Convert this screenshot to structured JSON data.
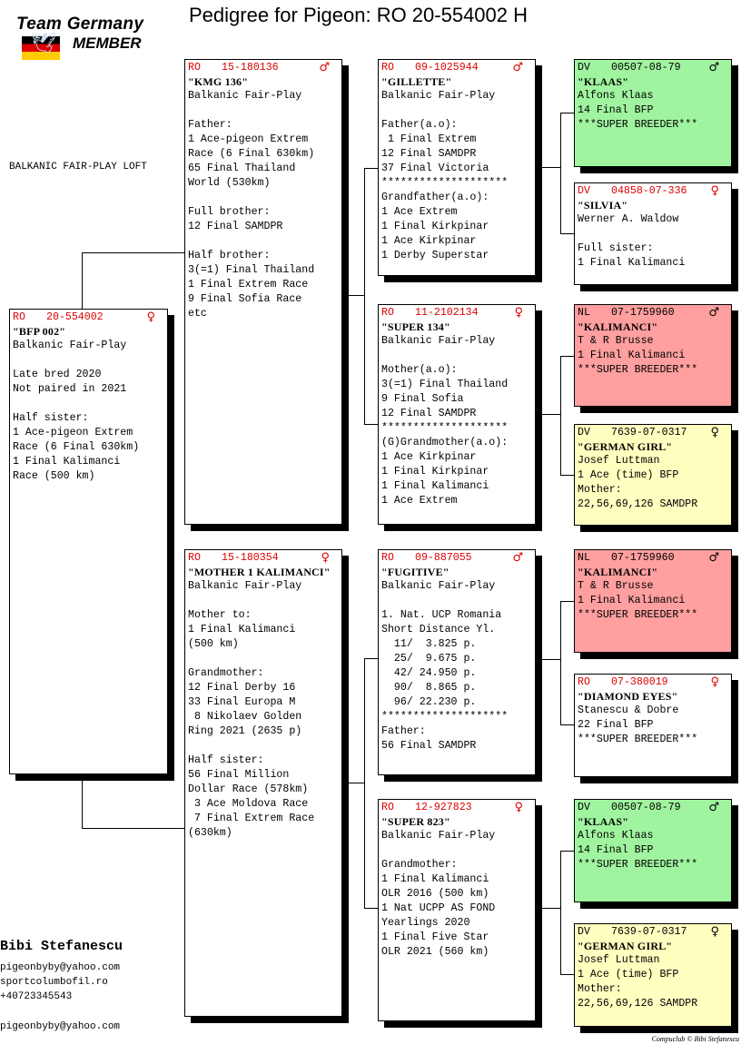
{
  "header": {
    "logo_line1": "Team Germany",
    "logo_line2": "MEMBER",
    "title": "Pedigree for Pigeon: RO  20-554002 H",
    "loft": "BALKANIC FAIR-PLAY LOFT"
  },
  "colors": {
    "ring_red": "#dd0000",
    "green": "#a0f4a0",
    "red": "#ff9f9f",
    "yellow": "#ffffc0",
    "white": "#ffffff"
  },
  "pigeons": [
    {
      "id": "subject",
      "cc": "RO",
      "ring": "20-554002",
      "sex": "female",
      "color": "white",
      "lines": [
        "\"BFP 002\"",
        "Balkanic Fair-Play",
        "",
        "Late bred 2020",
        "Not paired in 2021",
        "",
        "Half sister:",
        "1 Ace-pigeon Extrem",
        "Race (6 Final 630km)",
        "1 Final Kalimanci",
        "Race (500 km)"
      ]
    },
    {
      "id": "father",
      "cc": "RO",
      "ring": "15-180136",
      "sex": "male",
      "color": "white",
      "lines": [
        "\"KMG 136\"",
        "Balkanic Fair-Play",
        "",
        "Father:",
        "1 Ace-pigeon Extrem",
        "Race (6 Final 630km)",
        "65 Final Thailand",
        "World (530km)",
        "",
        "Full brother:",
        "12 Final SAMDPR",
        "",
        "Half brother:",
        "3(=1) Final Thailand",
        "1 Final Extrem Race",
        "9 Final Sofia Race",
        "etc"
      ]
    },
    {
      "id": "mother",
      "cc": "RO",
      "ring": "15-180354",
      "sex": "female",
      "color": "white",
      "lines": [
        "\"MOTHER 1 KALIMANCI\"",
        "Balkanic Fair-Play",
        "",
        "Mother to:",
        "1 Final Kalimanci",
        "(500 km)",
        "",
        "Grandmother:",
        "12 Final Derby 16",
        "33 Final Europa M",
        " 8 Nikolaev Golden",
        "Ring 2021 (2635 p)",
        "",
        "Half sister:",
        "56 Final Million",
        "Dollar Race (578km)",
        " 3 Ace Moldova Race",
        " 7 Final Extrem Race",
        "(630km)"
      ]
    },
    {
      "id": "ff",
      "cc": "RO",
      "ring": "09-1025944",
      "sex": "male",
      "color": "white",
      "lines": [
        "\"GILLETTE\"",
        "Balkanic Fair-Play",
        "",
        "Father(a.o):",
        " 1 Final Extrem",
        "12 Final SAMDPR",
        "37 Final Victoria",
        "********************",
        "Grandfather(a.o):",
        "1 Ace Extrem",
        "1 Final Kirkpinar",
        "1 Ace Kirkpinar",
        "1 Derby Superstar"
      ]
    },
    {
      "id": "fm",
      "cc": "RO",
      "ring": "11-2102134",
      "sex": "female",
      "color": "white",
      "lines": [
        "\"SUPER 134\"",
        "Balkanic Fair-Play",
        "",
        "Mother(a.o):",
        "3(=1) Final Thailand",
        "9 Final Sofia",
        "12 Final SAMDPR",
        "********************",
        "(G)Grandmother(a.o):",
        "1 Ace Kirkpinar",
        "1 Final Kirkpinar",
        "1 Final Kalimanci",
        "1 Ace Extrem"
      ]
    },
    {
      "id": "mf",
      "cc": "RO",
      "ring": "09-887055",
      "sex": "male",
      "color": "white",
      "lines": [
        "\"FUGITIVE\"",
        "Balkanic Fair-Play",
        "",
        "1. Nat. UCP Romania",
        "Short Distance Yl.",
        "  11/  3.825 p.",
        "  25/  9.675 p.",
        "  42/ 24.950 p.",
        "  90/  8.865 p.",
        "  96/ 22.230 p.",
        "********************",
        "Father:",
        "56 Final SAMDPR"
      ]
    },
    {
      "id": "mm",
      "cc": "RO",
      "ring": "12-927823",
      "sex": "female",
      "color": "white",
      "lines": [
        "\"SUPER 823\"",
        "Balkanic Fair-Play",
        "",
        "Grandmother:",
        "1 Final Kalimanci",
        "OLR 2016 (500 km)",
        "1 Nat UCPP AS FOND",
        "Yearlings 2020",
        "1 Final Five Star",
        "OLR 2021 (560 km)"
      ]
    },
    {
      "id": "fff",
      "cc": "DV",
      "ring": "00507-08-79",
      "sex": "male",
      "color": "green",
      "lines": [
        "\"KLAAS\"",
        "Alfons Klaas",
        "14 Final BFP",
        "***SUPER BREEDER***"
      ]
    },
    {
      "id": "ffm",
      "cc": "DV",
      "ring": "04858-07-336",
      "sex": "female",
      "color": "white",
      "lines": [
        "\"SILVIA\"",
        "Werner A. Waldow",
        "",
        "Full sister:",
        "1 Final Kalimanci"
      ]
    },
    {
      "id": "fmf",
      "cc": "NL",
      "ring": "07-1759960",
      "sex": "male",
      "color": "red",
      "lines": [
        "\"KALIMANCI\"",
        "T & R Brusse",
        "1 Final Kalimanci",
        "***SUPER BREEDER***"
      ]
    },
    {
      "id": "fmm",
      "cc": "DV",
      "ring": "7639-07-0317",
      "sex": "female",
      "color": "yellow",
      "lines": [
        "\"GERMAN GIRL\"",
        "Josef Luttman",
        "1 Ace (time) BFP",
        "Mother:",
        "22,56,69,126 SAMDPR"
      ]
    },
    {
      "id": "mff",
      "cc": "NL",
      "ring": "07-1759960",
      "sex": "male",
      "color": "red",
      "lines": [
        "\"KALIMANCI\"",
        "T & R Brusse",
        "1 Final Kalimanci",
        "***SUPER BREEDER***"
      ]
    },
    {
      "id": "mfm",
      "cc": "RO",
      "ring": "07-380019",
      "sex": "female",
      "color": "white",
      "lines": [
        "\"DIAMOND EYES\"",
        "Stanescu & Dobre",
        "22 Final BFP",
        "***SUPER BREEDER***"
      ]
    },
    {
      "id": "mmf",
      "cc": "DV",
      "ring": "00507-08-79",
      "sex": "male",
      "color": "green",
      "lines": [
        "\"KLAAS\"",
        "Alfons Klaas",
        "14 Final BFP",
        "***SUPER BREEDER***"
      ]
    },
    {
      "id": "mmm",
      "cc": "DV",
      "ring": "7639-07-0317",
      "sex": "female",
      "color": "yellow",
      "lines": [
        "\"GERMAN GIRL\"",
        "Josef Luttman",
        "1 Ace (time) BFP",
        "Mother:",
        "22,56,69,126 SAMDPR"
      ]
    }
  ],
  "footer": {
    "owner": "Bibi Stefanescu",
    "email": "pigeonbyby@yahoo.com",
    "website": "sportcolumbofil.ro",
    "phone": "+40723345543",
    "email2": "pigeonbyby@yahoo.com",
    "copyright": "Compuclub © Bibi Stefanescu"
  }
}
